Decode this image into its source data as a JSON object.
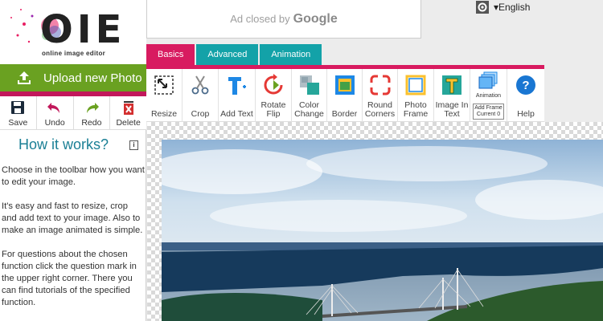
{
  "logo": {
    "mark": "OIE",
    "subtitle": "online image editor"
  },
  "sidebar": {
    "upload_label": "Upload new Photo",
    "actions": [
      {
        "label": "Save",
        "icon": "save-icon"
      },
      {
        "label": "Undo",
        "icon": "undo-icon"
      },
      {
        "label": "Redo",
        "icon": "redo-icon"
      },
      {
        "label": "Delete",
        "icon": "delete-icon"
      }
    ],
    "how_title": "How it works?",
    "how_paragraphs": [
      "Choose in the toolbar how you want to edit your image.",
      "It's easy and fast to resize, crop and add text to your image. Also to make an image animated is simple.",
      "For questions about the chosen function click the question mark in the upper right corner. There you can find tutorials of the specified function."
    ]
  },
  "ad": {
    "text": "Ad closed by",
    "brand": "Google"
  },
  "language": {
    "label": "▾English"
  },
  "tabs": [
    {
      "label": "Basics",
      "active": true
    },
    {
      "label": "Advanced",
      "active": false
    },
    {
      "label": "Animation",
      "active": false
    }
  ],
  "toolbar": {
    "tools": [
      {
        "label": "Resize",
        "icon": "resize-icon"
      },
      {
        "label": "Crop",
        "icon": "crop-icon"
      },
      {
        "label": "Add Text",
        "icon": "text-icon"
      },
      {
        "label": "Rotate Flip",
        "icon": "rotate-icon"
      },
      {
        "label": "Color Change",
        "icon": "color-change-icon"
      },
      {
        "label": "Border",
        "icon": "border-icon"
      },
      {
        "label": "Round Corners",
        "icon": "round-corners-icon"
      },
      {
        "label": "Photo Frame",
        "icon": "photo-frame-icon"
      },
      {
        "label": "Image In Text",
        "icon": "image-in-text-icon"
      }
    ],
    "animation": {
      "label": "Animation",
      "frame_label": "Add Frame Current 0"
    },
    "help_label": "Help"
  },
  "colors": {
    "accent_pink": "#d81b60",
    "tab_teal": "#13a2a8",
    "upload_green": "#6aa121",
    "title_teal": "#1a7f95"
  }
}
